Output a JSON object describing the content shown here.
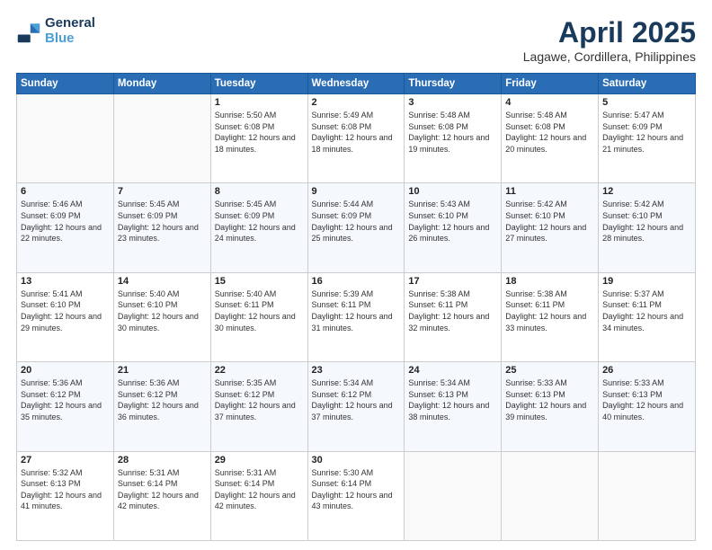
{
  "header": {
    "logo_line1": "General",
    "logo_line2": "Blue",
    "month": "April 2025",
    "location": "Lagawe, Cordillera, Philippines"
  },
  "days_of_week": [
    "Sunday",
    "Monday",
    "Tuesday",
    "Wednesday",
    "Thursday",
    "Friday",
    "Saturday"
  ],
  "weeks": [
    [
      {
        "day": "",
        "info": ""
      },
      {
        "day": "",
        "info": ""
      },
      {
        "day": "1",
        "info": "Sunrise: 5:50 AM\nSunset: 6:08 PM\nDaylight: 12 hours and 18 minutes."
      },
      {
        "day": "2",
        "info": "Sunrise: 5:49 AM\nSunset: 6:08 PM\nDaylight: 12 hours and 18 minutes."
      },
      {
        "day": "3",
        "info": "Sunrise: 5:48 AM\nSunset: 6:08 PM\nDaylight: 12 hours and 19 minutes."
      },
      {
        "day": "4",
        "info": "Sunrise: 5:48 AM\nSunset: 6:08 PM\nDaylight: 12 hours and 20 minutes."
      },
      {
        "day": "5",
        "info": "Sunrise: 5:47 AM\nSunset: 6:09 PM\nDaylight: 12 hours and 21 minutes."
      }
    ],
    [
      {
        "day": "6",
        "info": "Sunrise: 5:46 AM\nSunset: 6:09 PM\nDaylight: 12 hours and 22 minutes."
      },
      {
        "day": "7",
        "info": "Sunrise: 5:45 AM\nSunset: 6:09 PM\nDaylight: 12 hours and 23 minutes."
      },
      {
        "day": "8",
        "info": "Sunrise: 5:45 AM\nSunset: 6:09 PM\nDaylight: 12 hours and 24 minutes."
      },
      {
        "day": "9",
        "info": "Sunrise: 5:44 AM\nSunset: 6:09 PM\nDaylight: 12 hours and 25 minutes."
      },
      {
        "day": "10",
        "info": "Sunrise: 5:43 AM\nSunset: 6:10 PM\nDaylight: 12 hours and 26 minutes."
      },
      {
        "day": "11",
        "info": "Sunrise: 5:42 AM\nSunset: 6:10 PM\nDaylight: 12 hours and 27 minutes."
      },
      {
        "day": "12",
        "info": "Sunrise: 5:42 AM\nSunset: 6:10 PM\nDaylight: 12 hours and 28 minutes."
      }
    ],
    [
      {
        "day": "13",
        "info": "Sunrise: 5:41 AM\nSunset: 6:10 PM\nDaylight: 12 hours and 29 minutes."
      },
      {
        "day": "14",
        "info": "Sunrise: 5:40 AM\nSunset: 6:10 PM\nDaylight: 12 hours and 30 minutes."
      },
      {
        "day": "15",
        "info": "Sunrise: 5:40 AM\nSunset: 6:11 PM\nDaylight: 12 hours and 30 minutes."
      },
      {
        "day": "16",
        "info": "Sunrise: 5:39 AM\nSunset: 6:11 PM\nDaylight: 12 hours and 31 minutes."
      },
      {
        "day": "17",
        "info": "Sunrise: 5:38 AM\nSunset: 6:11 PM\nDaylight: 12 hours and 32 minutes."
      },
      {
        "day": "18",
        "info": "Sunrise: 5:38 AM\nSunset: 6:11 PM\nDaylight: 12 hours and 33 minutes."
      },
      {
        "day": "19",
        "info": "Sunrise: 5:37 AM\nSunset: 6:11 PM\nDaylight: 12 hours and 34 minutes."
      }
    ],
    [
      {
        "day": "20",
        "info": "Sunrise: 5:36 AM\nSunset: 6:12 PM\nDaylight: 12 hours and 35 minutes."
      },
      {
        "day": "21",
        "info": "Sunrise: 5:36 AM\nSunset: 6:12 PM\nDaylight: 12 hours and 36 minutes."
      },
      {
        "day": "22",
        "info": "Sunrise: 5:35 AM\nSunset: 6:12 PM\nDaylight: 12 hours and 37 minutes."
      },
      {
        "day": "23",
        "info": "Sunrise: 5:34 AM\nSunset: 6:12 PM\nDaylight: 12 hours and 37 minutes."
      },
      {
        "day": "24",
        "info": "Sunrise: 5:34 AM\nSunset: 6:13 PM\nDaylight: 12 hours and 38 minutes."
      },
      {
        "day": "25",
        "info": "Sunrise: 5:33 AM\nSunset: 6:13 PM\nDaylight: 12 hours and 39 minutes."
      },
      {
        "day": "26",
        "info": "Sunrise: 5:33 AM\nSunset: 6:13 PM\nDaylight: 12 hours and 40 minutes."
      }
    ],
    [
      {
        "day": "27",
        "info": "Sunrise: 5:32 AM\nSunset: 6:13 PM\nDaylight: 12 hours and 41 minutes."
      },
      {
        "day": "28",
        "info": "Sunrise: 5:31 AM\nSunset: 6:14 PM\nDaylight: 12 hours and 42 minutes."
      },
      {
        "day": "29",
        "info": "Sunrise: 5:31 AM\nSunset: 6:14 PM\nDaylight: 12 hours and 42 minutes."
      },
      {
        "day": "30",
        "info": "Sunrise: 5:30 AM\nSunset: 6:14 PM\nDaylight: 12 hours and 43 minutes."
      },
      {
        "day": "",
        "info": ""
      },
      {
        "day": "",
        "info": ""
      },
      {
        "day": "",
        "info": ""
      }
    ]
  ]
}
